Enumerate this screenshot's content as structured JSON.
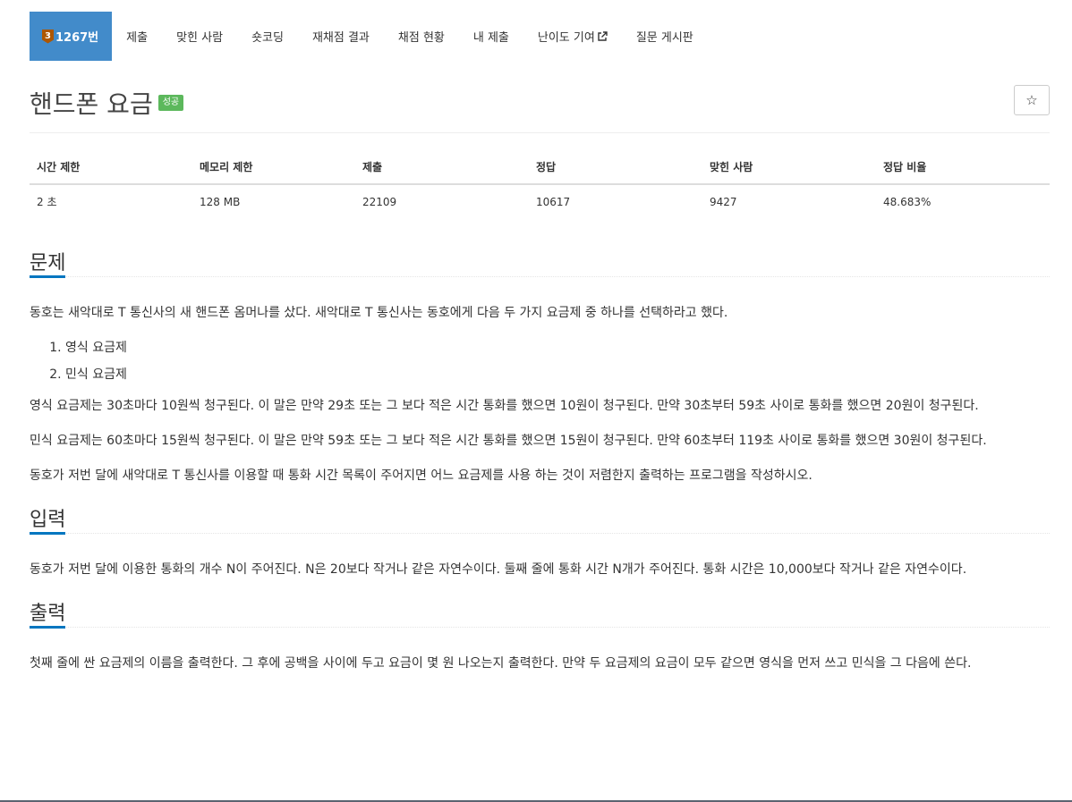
{
  "nav": {
    "problem_number": "1267번",
    "tier_level": "3",
    "items": [
      "제출",
      "맞힌 사람",
      "숏코딩",
      "재채점 결과",
      "채점 현황",
      "내 제출",
      "난이도 기여",
      "질문 게시판"
    ]
  },
  "title": "핸드폰 요금",
  "status": "성공",
  "star_icon": "☆",
  "info": {
    "headers": [
      "시간 제한",
      "메모리 제한",
      "제출",
      "정답",
      "맞힌 사람",
      "정답 비율"
    ],
    "values": [
      "2 초",
      "128 MB",
      "22109",
      "10617",
      "9427",
      "48.683%"
    ]
  },
  "sections": {
    "problem": {
      "title": "문제",
      "intro": "동호는 새악대로 T 통신사의 새 핸드폰 옴머나를 샀다. 새악대로 T 통신사는 동호에게 다음 두 가지 요금제 중 하나를 선택하라고 했다.",
      "list": [
        "영식 요금제",
        "민식 요금제"
      ],
      "p1": "영식 요금제는 30초마다 10원씩 청구된다. 이 말은 만약 29초 또는 그 보다 적은 시간 통화를 했으면 10원이 청구된다. 만약 30초부터 59초 사이로 통화를 했으면 20원이 청구된다.",
      "p2": "민식 요금제는 60초마다 15원씩 청구된다. 이 말은 만약 59초 또는 그 보다 적은 시간 통화를 했으면 15원이 청구된다. 만약 60초부터 119초 사이로 통화를 했으면 30원이 청구된다.",
      "p3": "동호가 저번 달에 새악대로 T 통신사를 이용할 때 통화 시간 목록이 주어지면 어느 요금제를 사용 하는 것이 저렴한지 출력하는 프로그램을 작성하시오."
    },
    "input": {
      "title": "입력",
      "text": "동호가 저번 달에 이용한 통화의 개수 N이 주어진다. N은 20보다 작거나 같은 자연수이다. 둘째 줄에 통화 시간 N개가 주어진다. 통화 시간은 10,000보다 작거나 같은 자연수이다."
    },
    "output": {
      "title": "출력",
      "text": "첫째 줄에 싼 요금제의 이름을 출력한다. 그 후에 공백을 사이에 두고 요금이 몇 원 나오는지 출력한다. 만약 두 요금제의 요금이 모두 같으면 영식을 먼저 쓰고 민식을 그 다음에 쓴다."
    }
  },
  "colors": {
    "accent": "#428bca",
    "success": "#5cb85c",
    "tier": "#ad5600",
    "section_underline": "#0076c0"
  }
}
